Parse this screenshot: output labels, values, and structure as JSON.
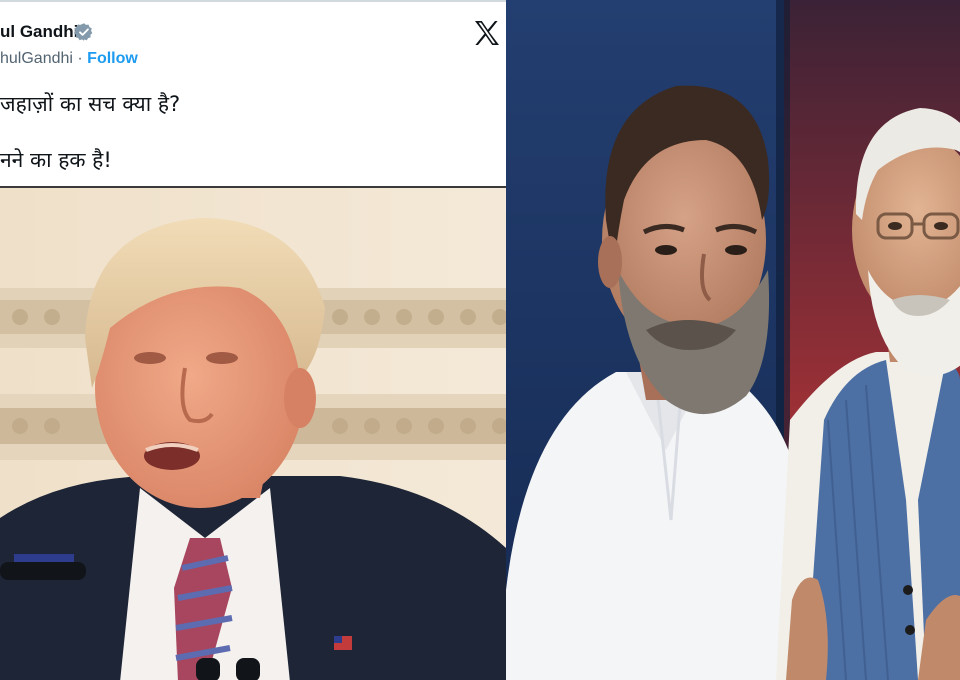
{
  "tweet": {
    "display_name": "ul Gandhi",
    "handle": "hulGandhi",
    "separator": " · ",
    "follow_label": "Follow",
    "line1": " जहाज़ों का सच क्या है?",
    "line2": "नने का हक है!",
    "icons": {
      "verified": "verified-badge-icon",
      "platform": "x-logo-icon"
    }
  },
  "colors": {
    "follow_link": "#1d9bf0",
    "verified_badge": "#829aab",
    "name_text": "#0f1419",
    "handle_text": "#536471",
    "photo_background_left": "#1f3a6b",
    "photo_background_right": "#8a2a32"
  }
}
